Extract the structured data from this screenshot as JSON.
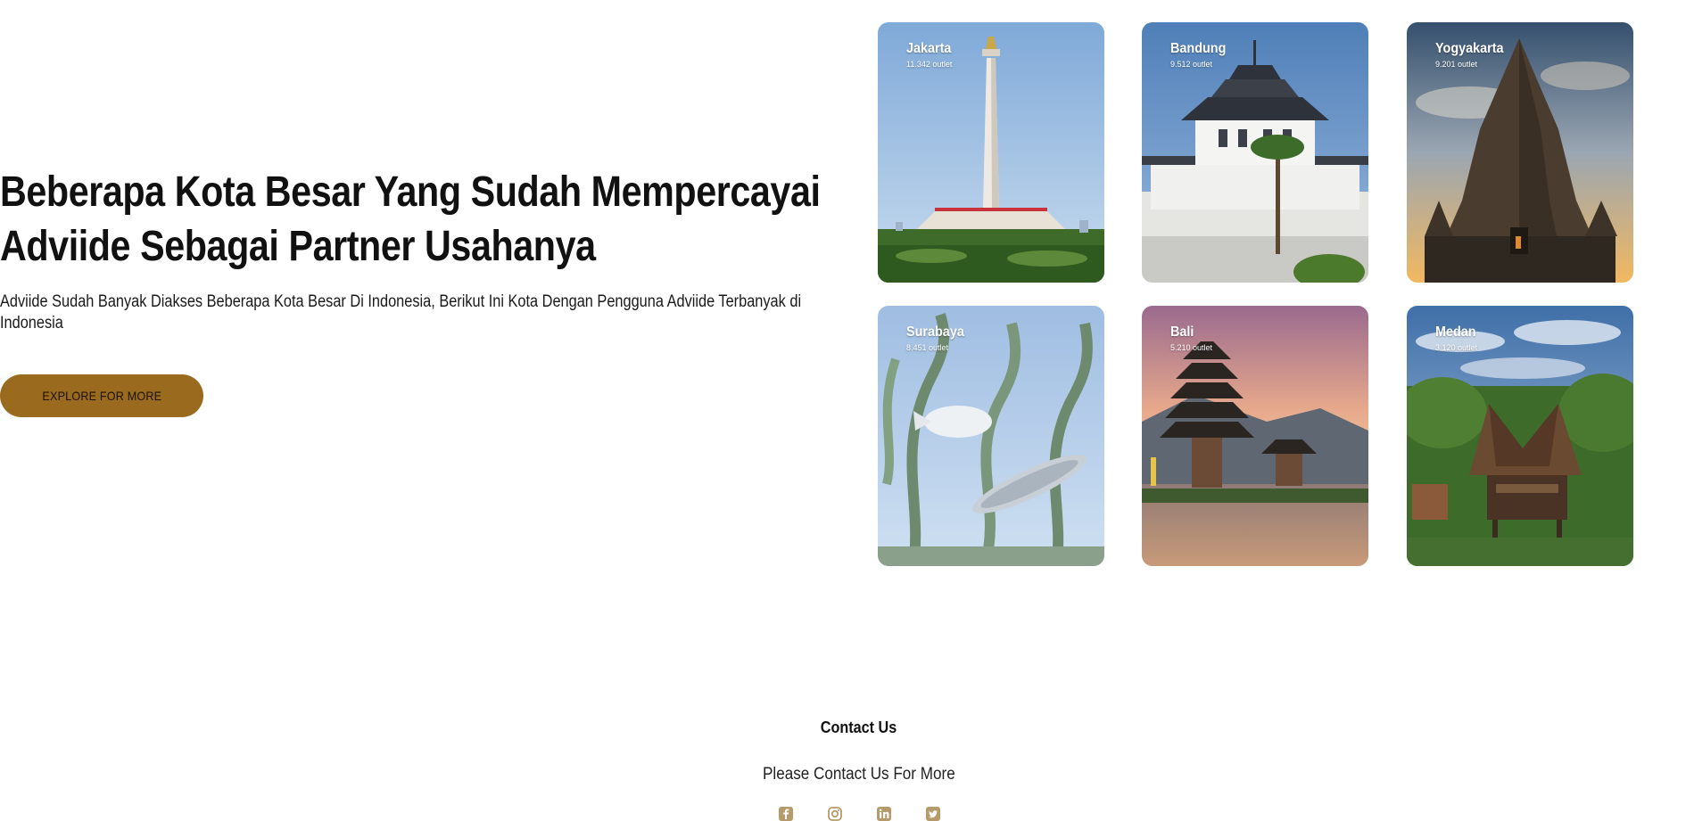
{
  "hero": {
    "title": "Beberapa Kota Besar Yang Sudah Mempercayai Adviide Sebagai Partner Usahanya",
    "description": "Adviide Sudah Banyak Diakses Beberapa Kota Besar Di Indonesia, Berikut Ini Kota Dengan Pengguna Adviide Terbanyak di Indonesia",
    "button_label": "EXPLORE FOR MORE"
  },
  "cities": [
    {
      "name": "Jakarta",
      "outlets": "11.342 outlet"
    },
    {
      "name": "Bandung",
      "outlets": "9.512 outlet"
    },
    {
      "name": "Yogyakarta",
      "outlets": "9.201 outlet"
    },
    {
      "name": "Surabaya",
      "outlets": "8.451 outlet"
    },
    {
      "name": "Bali",
      "outlets": "5.210 outlet"
    },
    {
      "name": "Medan",
      "outlets": "3.120 outlet"
    }
  ],
  "contact": {
    "title": "Contact Us",
    "subtitle": "Please Contact Us For More",
    "socials": [
      "facebook-icon",
      "instagram-icon",
      "linkedin-icon",
      "twitter-icon"
    ]
  },
  "colors": {
    "accent": "#9a6a1f",
    "social_icon": "#b59a6b"
  }
}
